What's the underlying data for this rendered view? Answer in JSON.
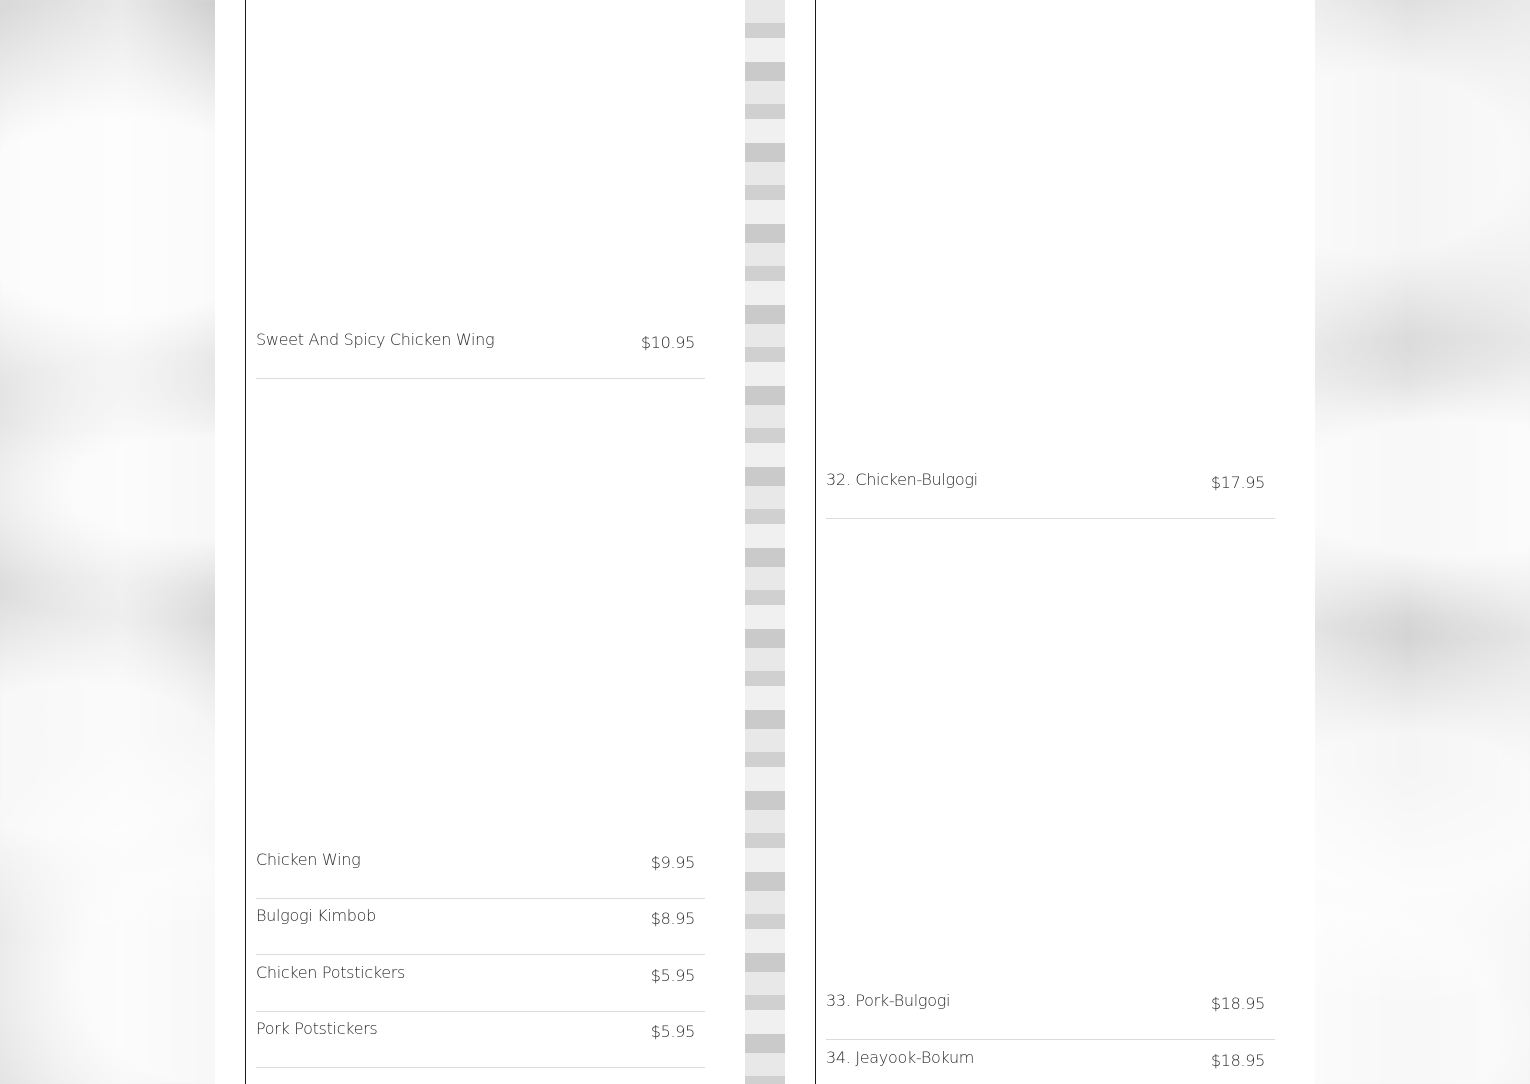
{
  "left_panel": {
    "items": [
      {
        "name": "Sweet And Spicy Chicken Wing",
        "price": "$10.95"
      },
      {
        "name": "Chicken Wing",
        "price": "$9.95"
      },
      {
        "name": "Bulgogi Kimbob",
        "price": "$8.95"
      },
      {
        "name": "Chicken Potstickers",
        "price": "$5.95"
      },
      {
        "name": "Pork Potstickers",
        "price": "$5.95"
      }
    ]
  },
  "right_panel": {
    "items": [
      {
        "name": "32. Chicken-Bulgogi",
        "price": "$17.95"
      },
      {
        "name": "33. Pork-Bulgogi",
        "price": "$18.95"
      },
      {
        "name": "34. Jeayook-Bokum",
        "price": "$18.95"
      }
    ]
  }
}
